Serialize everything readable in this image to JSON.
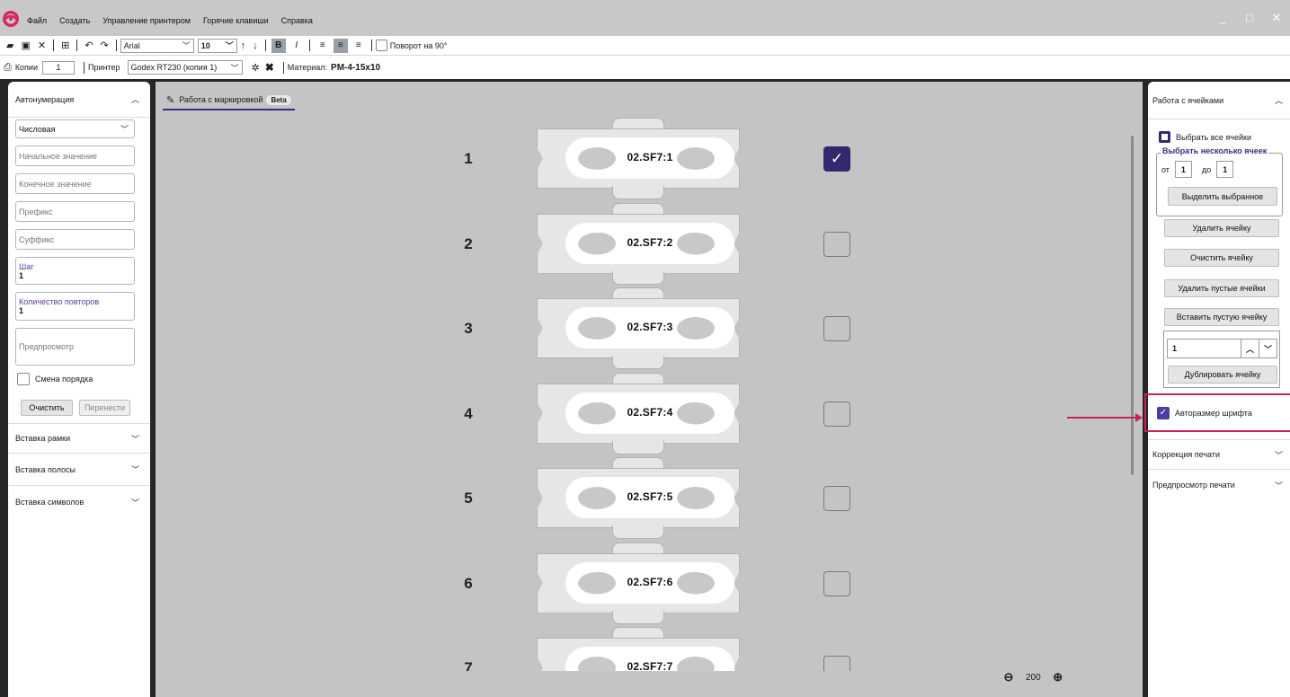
{
  "menu": [
    "Файл",
    "Создать",
    "Управление принтером",
    "Горячие клавиши",
    "Справка"
  ],
  "window_controls": [
    "_",
    "□",
    "✕"
  ],
  "toolbar1": {
    "font": "Arial",
    "size": "10",
    "rotate_label": "Поворот на 90°"
  },
  "toolbar2": {
    "copies_label": "Копии",
    "copies_value": "1",
    "printer_label": "Принтер",
    "printer_value": "Godex RT230 (копия 1)",
    "material_label": "Материал:",
    "material_value": "PM-4-15x10"
  },
  "left": {
    "autonum_title": "Автонумерация",
    "type_value": "Числовая",
    "start_placeholder": "Начальное значение",
    "end_placeholder": "Конечное значение",
    "prefix_placeholder": "Префикс",
    "suffix_placeholder": "Суффикс",
    "step_label": "Шаг",
    "step_value": "1",
    "repeat_label": "Количество повторов",
    "repeat_value": "1",
    "preview_placeholder": "Предпросмотр",
    "order_label": "Смена порядка",
    "clear_label": "Очистить",
    "transfer_label": "Перенести",
    "frame_title": "Вставка рамки",
    "stripe_title": "Вставка полосы",
    "symbols_title": "Вставка символов"
  },
  "canvas": {
    "tab_label": "Работа с маркировкой",
    "beta": "Beta",
    "rows": [
      {
        "num": "1",
        "text": "02.SF7:1",
        "checked": true
      },
      {
        "num": "2",
        "text": "02.SF7:2",
        "checked": false
      },
      {
        "num": "3",
        "text": "02.SF7:3",
        "checked": false
      },
      {
        "num": "4",
        "text": "02.SF7:4",
        "checked": false
      },
      {
        "num": "5",
        "text": "02.SF7:5",
        "checked": false
      },
      {
        "num": "6",
        "text": "02.SF7:6",
        "checked": false
      },
      {
        "num": "7",
        "text": "02.SF7:7",
        "checked": false
      }
    ],
    "zoom": "200"
  },
  "right": {
    "cells_title": "Работа с ячейками",
    "select_all": "Выбрать все ячейки",
    "select_multi": "Выбрать несколько ячеек",
    "from_label": "от",
    "from_value": "1",
    "to_label": "до",
    "to_value": "1",
    "select_btn": "Выделить выбранное",
    "delete_btn": "Удалить ячейку",
    "clear_btn": "Очистить ячейку",
    "delete_empty_btn": "Удалить пустые ячейки",
    "insert_empty_btn": "Вставить пустую ячейку",
    "dup_value": "1",
    "dup_btn": "Дублировать ячейку",
    "autosize_label": "Авторазмер шрифта",
    "print_corr_title": "Коррекция печати",
    "print_preview_title": "Предпросмотр печати"
  },
  "colors": {
    "accent": "#33296f",
    "highlight": "#c8215e"
  }
}
